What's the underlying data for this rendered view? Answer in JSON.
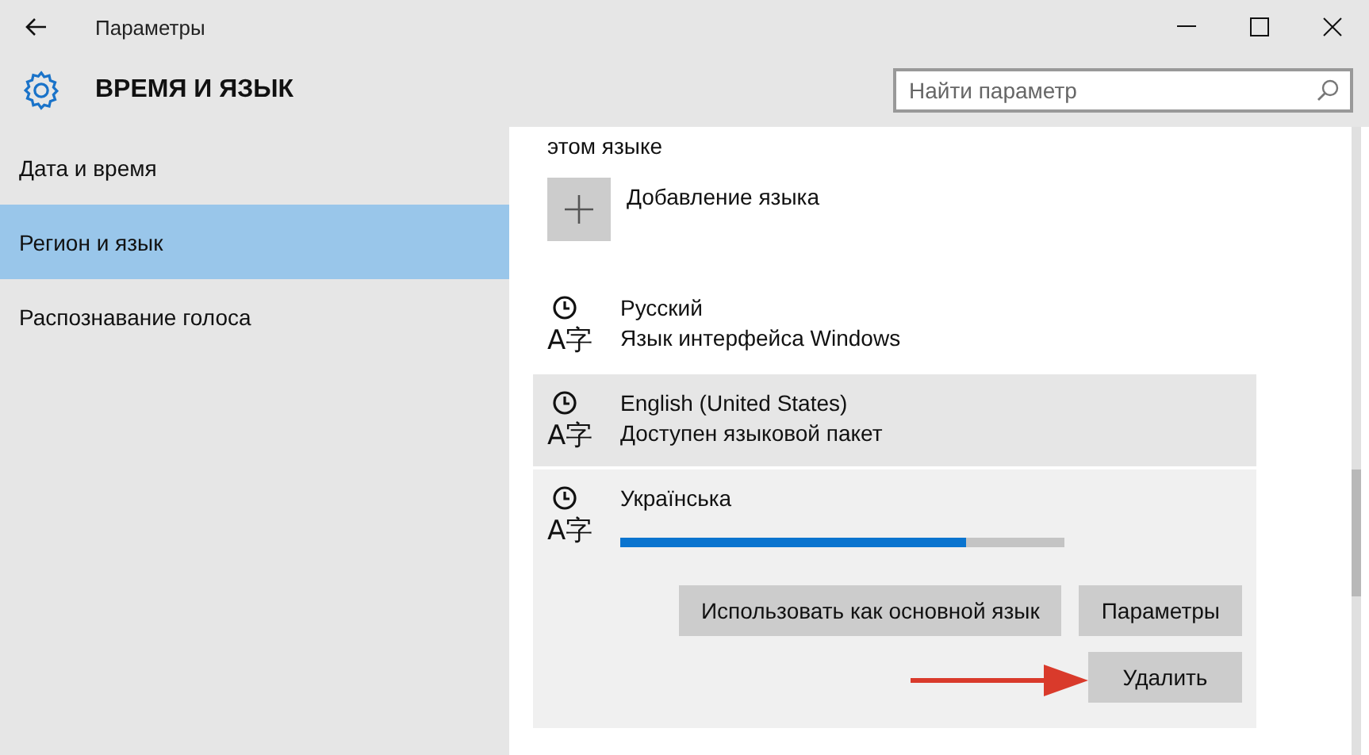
{
  "window": {
    "title": "Параметры"
  },
  "header": {
    "title": "ВРЕМЯ И ЯЗЫК"
  },
  "search": {
    "placeholder": "Найти параметр"
  },
  "sidebar": {
    "items": [
      {
        "label": "Дата и время",
        "selected": false
      },
      {
        "label": "Регион и язык",
        "selected": true
      },
      {
        "label": "Распознавание голоса",
        "selected": false
      }
    ]
  },
  "content": {
    "cut_text": "этом языке",
    "add_language": {
      "label": "Добавление языка"
    },
    "languages": [
      {
        "name": "Русский",
        "status": "Язык интерфейса Windows",
        "icon_text": "A字",
        "selected": false,
        "hovered": false
      },
      {
        "name": "English (United States)",
        "status": "Доступен языковой пакет",
        "icon_text": "A字",
        "selected": false,
        "hovered": true
      },
      {
        "name": "Українська",
        "icon_text": "A字",
        "selected": true,
        "hovered": false,
        "level": 0.78,
        "buttons": [
          {
            "label": "Использовать как основной язык"
          },
          {
            "label": "Параметры"
          }
        ],
        "extra_buttons": [
          {
            "label": "Удалить"
          }
        ]
      }
    ]
  },
  "annotation_arrow": true
}
